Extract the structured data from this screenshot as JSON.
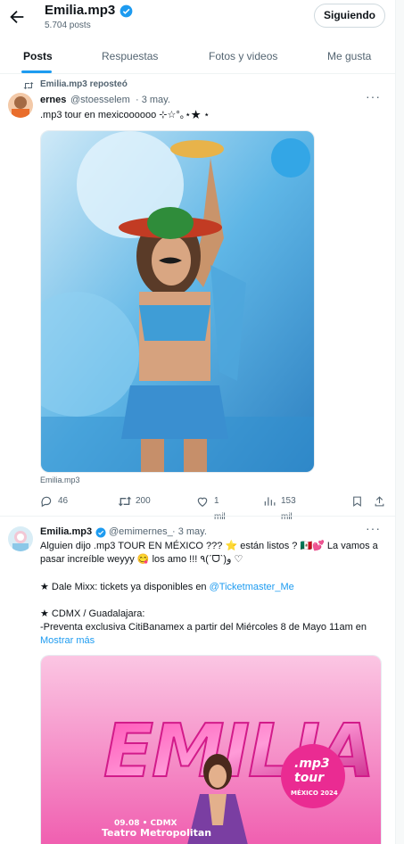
{
  "header": {
    "name": "Emilia.mp3",
    "posts_count": "5.704 posts",
    "follow_label": "Siguiendo"
  },
  "tabs": [
    {
      "label": "Posts"
    },
    {
      "label": "Respuestas"
    },
    {
      "label": "Fotos y videos"
    },
    {
      "label": "Me gusta"
    }
  ],
  "repost_label": "Emilia.mp3 reposteó",
  "tweet1": {
    "name": "ernes",
    "handle": "@stoesselem",
    "date": "· 3 may.",
    "text": ".mp3 tour en mexicoooooo ⊹☆°｡⋆★ ⋆",
    "media_caption": "Emilia.mp3",
    "replies": "46",
    "reposts": "200",
    "likes": "1 mil",
    "views": "153 mil"
  },
  "tweet2": {
    "name": "Emilia.mp3",
    "handle": "@emimernes_",
    "date": "· 3 may.",
    "line1": "Alguien dijo .mp3 TOUR EN MÉXICO ??? ⭐ están listos ? 🇲🇽💕 La vamos a",
    "line2": "pasar increíble weyyy 😋 los amo !!! ٩(ˊᗜˋ)و ♡",
    "line3_prefix": "★ Dale Mixx: tickets ya disponibles en ",
    "line3_link": "@Ticketmaster_Me",
    "line4": "★ CDMX / Guadalajara:",
    "line5": "-Preventa exclusiva CitiBanamex a partir del Miércoles 8 de Mayo 11am en",
    "show_more": "Mostrar más",
    "poster_title": "EMILIA",
    "poster_badge_1": ".mp3",
    "poster_badge_2": "tour",
    "poster_badge_3": "MÉXICO 2024",
    "poster_date": "09.08 • CDMX",
    "poster_venue": "Teatro Metropolitan"
  },
  "colors": {
    "accent": "#1d9bf0",
    "text": "#0f1419",
    "muted": "#536471"
  }
}
